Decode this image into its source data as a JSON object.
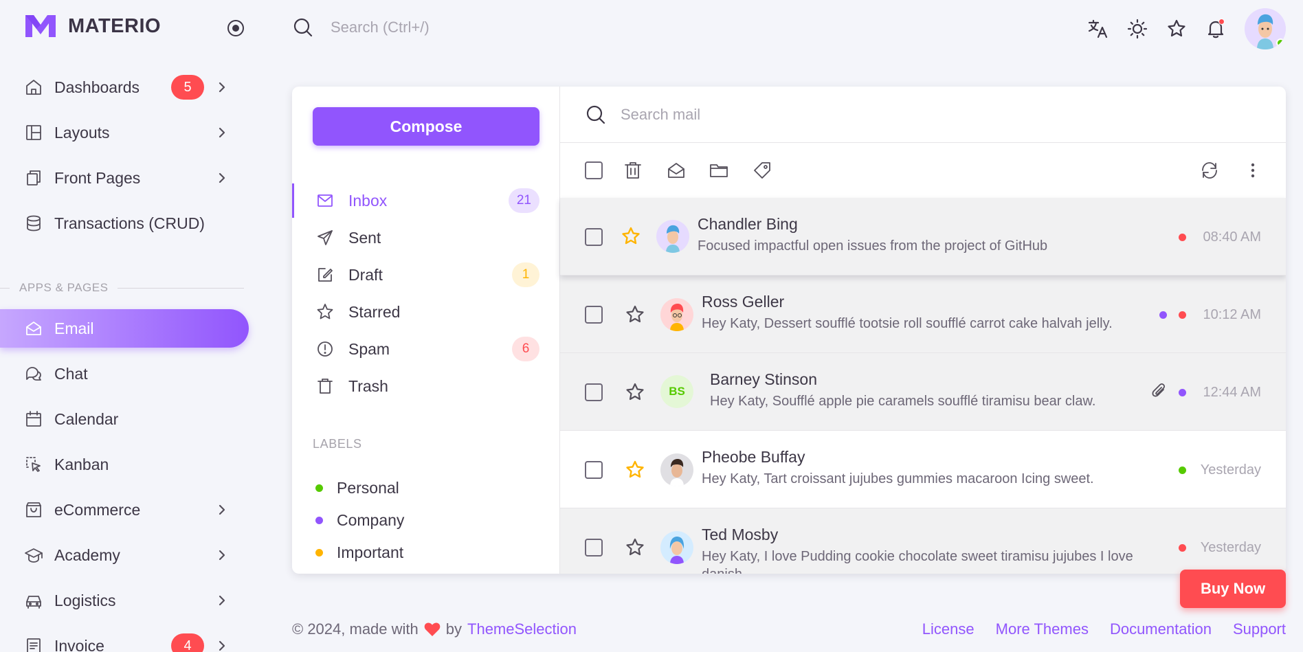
{
  "brand": {
    "name": "MATERIO",
    "accent": "#9155fd"
  },
  "sidebar": {
    "items": [
      {
        "label": "Dashboards",
        "badge": "5",
        "icon": "home-icon"
      },
      {
        "label": "Layouts",
        "icon": "layout-icon"
      },
      {
        "label": "Front Pages",
        "icon": "pages-icon"
      },
      {
        "label": "Transactions (CRUD)",
        "icon": "database-icon"
      },
      {
        "label": "Email",
        "icon": "mail-open-icon",
        "active": true
      },
      {
        "label": "Chat",
        "icon": "chat-icon"
      },
      {
        "label": "Calendar",
        "icon": "calendar-icon"
      },
      {
        "label": "Kanban",
        "icon": "kanban-icon"
      },
      {
        "label": "eCommerce",
        "icon": "shopping-bag-icon"
      },
      {
        "label": "Academy",
        "icon": "graduation-cap-icon"
      },
      {
        "label": "Logistics",
        "icon": "truck-icon"
      },
      {
        "label": "Invoice",
        "badge": "4",
        "icon": "invoice-icon"
      }
    ],
    "section_header": "APPS & PAGES"
  },
  "topbar": {
    "search_placeholder": "Search (Ctrl+/)"
  },
  "mail": {
    "compose_label": "Compose",
    "folders": [
      {
        "label": "Inbox",
        "count": "21",
        "icon": "mail-icon"
      },
      {
        "label": "Sent",
        "icon": "send-icon"
      },
      {
        "label": "Draft",
        "count": "1",
        "icon": "draft-icon"
      },
      {
        "label": "Starred",
        "icon": "star-icon"
      },
      {
        "label": "Spam",
        "count": "6",
        "icon": "alert-icon"
      },
      {
        "label": "Trash",
        "icon": "trash-icon"
      }
    ],
    "labels_header": "LABELS",
    "labels": [
      {
        "label": "Personal",
        "color": "#56ca00"
      },
      {
        "label": "Company",
        "color": "#9155fd"
      },
      {
        "label": "Important",
        "color": "#ffb400"
      }
    ],
    "search_placeholder": "Search mail",
    "emails": [
      {
        "name": "Chandler Bing",
        "message": "Focused impactful open issues from the project of GitHub",
        "time": "08:40 AM",
        "starred": true,
        "read": true
      },
      {
        "name": "Ross Geller",
        "message": "Hey Katy, Dessert soufflé tootsie roll soufflé carrot cake halvah jelly.",
        "time": "10:12 AM",
        "starred": false,
        "read": true
      },
      {
        "name": "Barney Stinson",
        "initials": "BS",
        "message": "Hey Katy, Soufflé apple pie caramels soufflé tiramisu bear claw.",
        "time": "12:44 AM",
        "starred": false,
        "read": true,
        "attachment": true
      },
      {
        "name": "Pheobe Buffay",
        "message": "Hey Katy, Tart croissant jujubes gummies macaroon Icing sweet.",
        "time": "Yesterday",
        "starred": true,
        "read": false
      },
      {
        "name": "Ted Mosby",
        "message": "Hey Katy, I love Pudding cookie chocolate sweet tiramisu jujubes I love",
        "message_cont": "danish",
        "time": "Yesterday",
        "starred": false,
        "read": true
      }
    ]
  },
  "footer": {
    "copyright": "© 2024, made with",
    "by": "by",
    "brand": "ThemeSelection",
    "links": [
      "License",
      "More Themes",
      "Documentation",
      "Support"
    ]
  },
  "buy_now": "Buy Now",
  "colors": {
    "danger": "#ff4c51",
    "success": "#56ca00",
    "warning": "#ffb400"
  }
}
